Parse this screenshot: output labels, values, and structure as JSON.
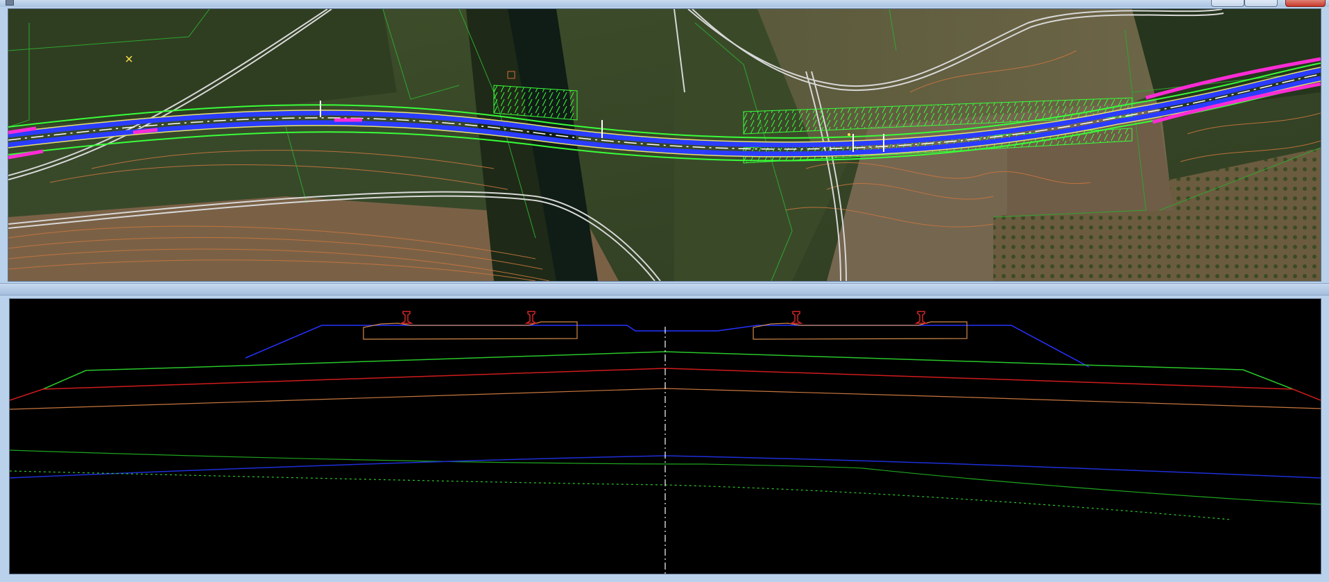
{
  "window": {
    "title": "",
    "icon": "app-window-icon",
    "controls": [
      "minimize-icon",
      "maximize-icon",
      "close-icon"
    ]
  },
  "plan_view": {
    "background": "aerial-imagery",
    "colors": {
      "alignment": "#4a6cff",
      "centerline": "#ffffff",
      "edge": "#e8e06a",
      "earthworks": "#39ff39",
      "highlight": "#ff2bd6",
      "contours": "#c8763e",
      "roads": "#d8d8d8"
    }
  },
  "section_view": {
    "background": "#000000",
    "colors": {
      "formation": "#2633ff",
      "ground_green": "#29c729",
      "ground_red": "#d01c1c",
      "ground_orange": "#c8763e",
      "rail": "#d42626",
      "ballast": "#d28a4a",
      "axis": "#ffffff",
      "lower_blue": "#1f2fd8",
      "lower_green": "#1fa51f",
      "dashed_green": "#2fc92f"
    }
  }
}
